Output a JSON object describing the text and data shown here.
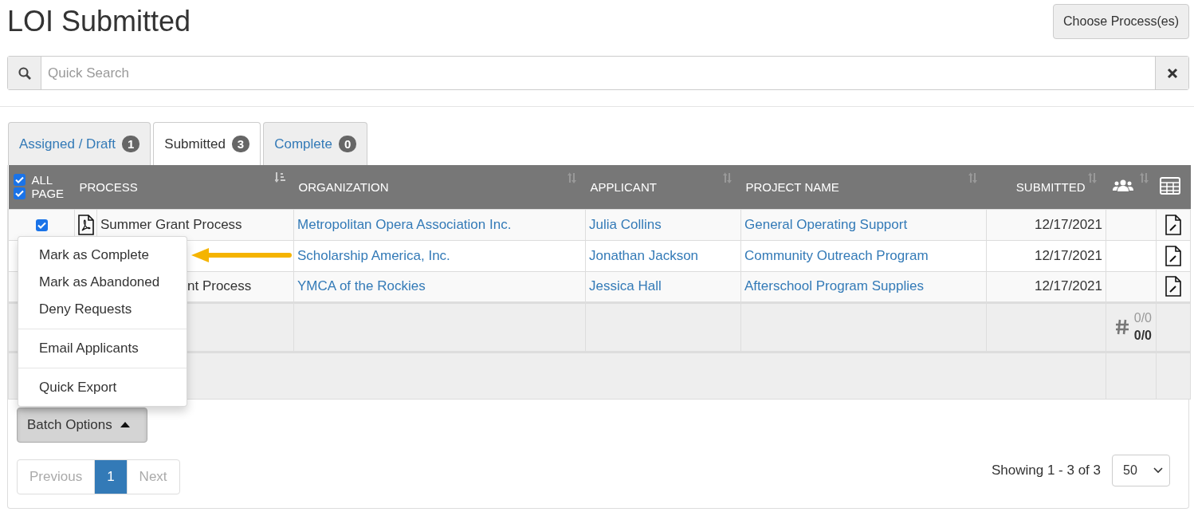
{
  "page_title": "LOI Submitted",
  "choose_button": "Choose Process(es)",
  "search": {
    "placeholder": "Quick Search"
  },
  "tabs": [
    {
      "label": "Assigned / Draft",
      "count": "1",
      "selected": false
    },
    {
      "label": "Submitted",
      "count": "3",
      "selected": true
    },
    {
      "label": "Complete",
      "count": "0",
      "selected": false
    }
  ],
  "select_all": [
    {
      "label": "ALL",
      "checked": true
    },
    {
      "label": "PAGE",
      "checked": true
    }
  ],
  "columns": [
    {
      "label": "PROCESS",
      "sorted": true
    },
    {
      "label": "ORGANIZATION",
      "sorted": false
    },
    {
      "label": "APPLICANT",
      "sorted": false
    },
    {
      "label": "PROJECT NAME",
      "sorted": false
    },
    {
      "label": "SUBMITTED",
      "sorted": false
    }
  ],
  "rows": [
    {
      "checked": true,
      "process": "Summer Grant Process",
      "organization": "Metropolitan Opera Association Inc.",
      "applicant": "Julia Collins",
      "project": "General Operating Support",
      "submitted": "12/17/2021"
    },
    {
      "organization": "Scholarship America, Inc.",
      "applicant": "Jonathan Jackson",
      "project": "Community Outreach Program",
      "submitted": "12/17/2021"
    },
    {
      "process": "nt Process",
      "organization": "YMCA of the Rockies",
      "applicant": "Jessica Hall",
      "project": "Afterschool Program Supplies",
      "submitted": "12/17/2021"
    }
  ],
  "summary": {
    "top": "0/0",
    "bottom": "0/0"
  },
  "batch": {
    "label": "Batch Options",
    "expanded": true,
    "menu_groups": [
      [
        "Mark as Complete",
        "Mark as Abandoned",
        "Deny Requests"
      ],
      [
        "Email Applicants"
      ],
      [
        "Quick Export"
      ]
    ]
  },
  "pagination": {
    "previous": {
      "label": "Previous",
      "disabled": true
    },
    "pages": [
      {
        "label": "1",
        "selected": true
      }
    ],
    "next": {
      "label": "Next",
      "disabled": true
    }
  },
  "showing": "Showing 1 - 3 of 3",
  "page_size": "50"
}
